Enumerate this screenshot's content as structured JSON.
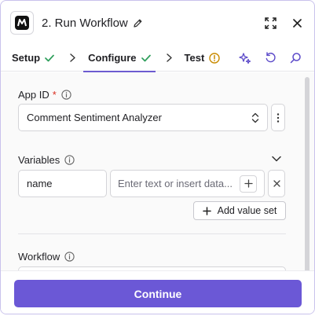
{
  "header": {
    "title": "2. Run Workflow",
    "logo_icon": "app-logo-icon",
    "actions": [
      "expand-icon",
      "close-icon"
    ]
  },
  "tabs": [
    {
      "label": "Setup",
      "status": "complete"
    },
    {
      "label": "Configure",
      "status": "complete",
      "active": true
    },
    {
      "label": "Test",
      "status": "warning"
    }
  ],
  "tab_actions": [
    "sparkle-icon",
    "refresh-icon",
    "search-icon"
  ],
  "fields": {
    "app_id": {
      "label": "App ID",
      "required_mark": "*",
      "value": "Comment Sentiment Analyzer"
    },
    "variables": {
      "label": "Variables",
      "rows": [
        {
          "key": "name",
          "value_placeholder": "Enter text or insert data..."
        }
      ],
      "add_label": "Add value set"
    },
    "workflow": {
      "label": "Workflow"
    }
  },
  "footer": {
    "continue_label": "Continue"
  },
  "colors": {
    "accent": "#6b58d6",
    "check_green": "#2e9e5b",
    "warning": "#c98b00",
    "required": "#d92d20"
  }
}
